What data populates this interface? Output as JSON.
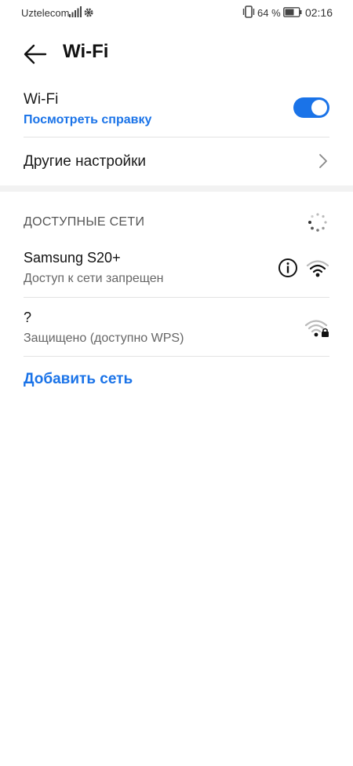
{
  "status_bar": {
    "carrier": "Uztelecom",
    "battery_percent": "64 %",
    "time": "02:16"
  },
  "header": {
    "title": "Wi-Fi"
  },
  "wifi": {
    "label": "Wi-Fi",
    "help_link": "Посмотреть справку",
    "enabled": true
  },
  "other_settings": {
    "label": "Другие настройки"
  },
  "available": {
    "title": "ДОСТУПНЫЕ СЕТИ",
    "networks": [
      {
        "name": "Samsung S20+",
        "status": "Доступ к сети запрещен",
        "icon": "wifi-signal-icon",
        "has_info": true
      },
      {
        "name": "?",
        "status": "Защищено (доступно WPS)",
        "icon": "wifi-lock-icon",
        "has_info": false
      }
    ]
  },
  "add_network": {
    "label": "Добавить сеть"
  },
  "colors": {
    "accent": "#1a73e8"
  }
}
